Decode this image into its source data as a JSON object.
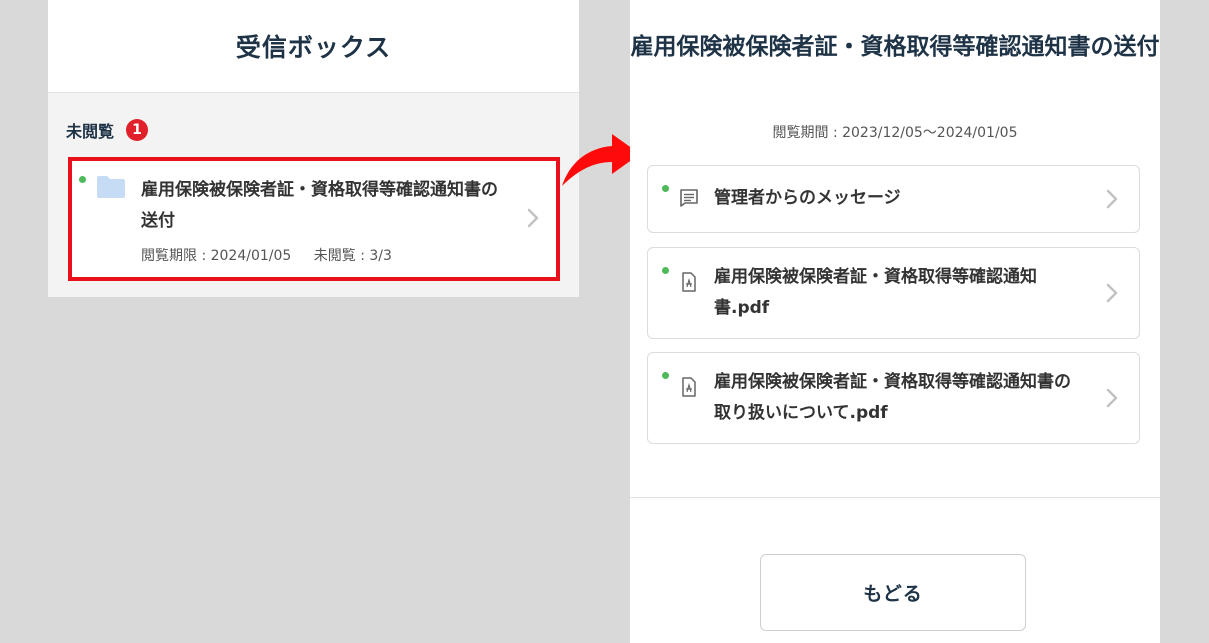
{
  "inbox": {
    "title": "受信ボックス",
    "section_label": "未閲覧",
    "unread_badge": "1",
    "item": {
      "title": "雇用保険被保険者証・資格取得等確認通知書の送付",
      "deadline": "閲覧期限 : 2024/01/05",
      "unread_count": "未閲覧 : 3/3"
    }
  },
  "detail": {
    "title": "雇用保険被保険者証・資格取得等確認通知書の送付",
    "period": "閲覧期間 : 2023/12/05～2024/01/05",
    "items": [
      {
        "label": "管理者からのメッセージ",
        "icon": "message-icon"
      },
      {
        "label": "雇用保険被保険者証・資格取得等確認通知書.pdf",
        "icon": "pdf-icon"
      },
      {
        "label": "雇用保険被保険者証・資格取得等確認通知書の取り扱いについて.pdf",
        "icon": "pdf-icon"
      }
    ],
    "back_label": "もどる"
  },
  "colors": {
    "highlight": "#e8101a",
    "badge": "#e0202a",
    "unread_dot": "#4db95b",
    "title_text": "#1f3347",
    "folder": "#c6dcf5",
    "arrow": "#ff0a0a"
  }
}
